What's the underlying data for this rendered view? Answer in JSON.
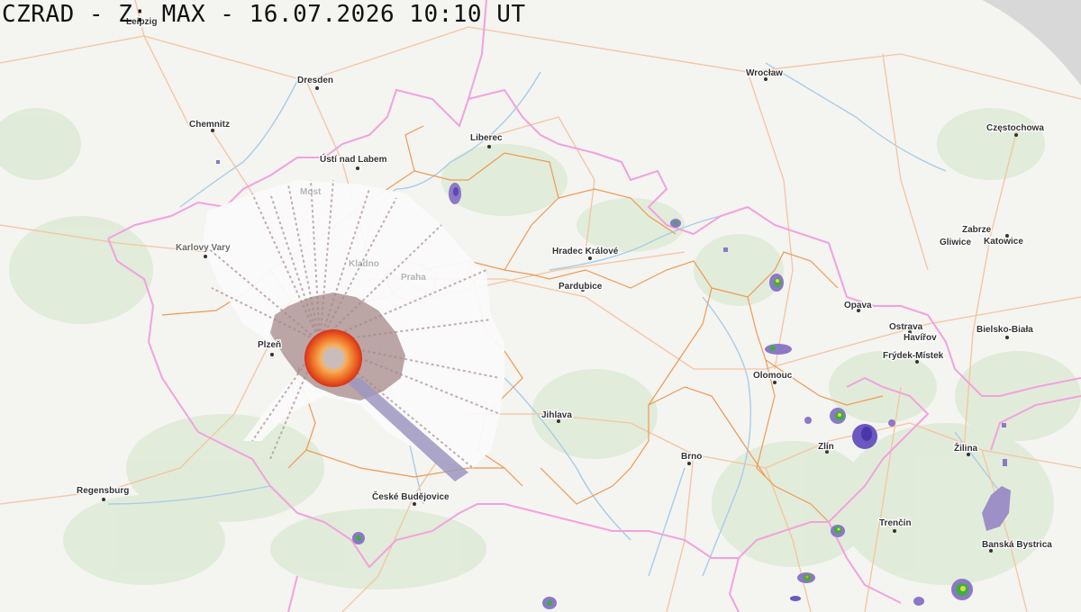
{
  "header": {
    "title": "CZRAD - Z: MAX - 16.07.2026 10:10 UT"
  },
  "colors": {
    "country_border": "#f3a3e0",
    "region_border": "#ef9a50",
    "road": "#f6c8a6",
    "water": "#a8cde8",
    "forest": "#dce9d4",
    "background": "#f4f4f1",
    "radar_coverage": "#fafafa",
    "echo_weak": "#8c78c6",
    "echo_moderate": "#3fae3f",
    "echo_strong": "#f29a1c",
    "echo_intense": "#e23c1c",
    "clutter": "#a08888"
  },
  "cities": [
    {
      "id": "leipzig",
      "name": "Leipzig"
    },
    {
      "id": "dresden",
      "name": "Dresden"
    },
    {
      "id": "chemnitz",
      "name": "Chemnitz"
    },
    {
      "id": "wroclaw",
      "name": "Wrocław"
    },
    {
      "id": "czestochowa",
      "name": "Częstochowa"
    },
    {
      "id": "liberec",
      "name": "Liberec"
    },
    {
      "id": "usti",
      "name": "Ústí nad Labem"
    },
    {
      "id": "most",
      "name": "Most"
    },
    {
      "id": "karlovy-vary",
      "name": "Karlovy Vary"
    },
    {
      "id": "kladno",
      "name": "Kladno"
    },
    {
      "id": "praha",
      "name": "Praha"
    },
    {
      "id": "hradec",
      "name": "Hradec Králové"
    },
    {
      "id": "pardubice",
      "name": "Pardubice"
    },
    {
      "id": "zabrze",
      "name": "Zabrze"
    },
    {
      "id": "gliwice",
      "name": "Gliwice"
    },
    {
      "id": "katowice",
      "name": "Katowice"
    },
    {
      "id": "opava",
      "name": "Opava"
    },
    {
      "id": "ostrava",
      "name": "Ostrava"
    },
    {
      "id": "havirov",
      "name": "Havířov"
    },
    {
      "id": "frydek",
      "name": "Frýdek-Místek"
    },
    {
      "id": "bielsko",
      "name": "Bielsko-Biała"
    },
    {
      "id": "plzen",
      "name": "Plzeň"
    },
    {
      "id": "olomouc",
      "name": "Olomouc"
    },
    {
      "id": "jihlava",
      "name": "Jihlava"
    },
    {
      "id": "zlin",
      "name": "Zlín"
    },
    {
      "id": "brno",
      "name": "Brno"
    },
    {
      "id": "zilina",
      "name": "Žilina"
    },
    {
      "id": "regensburg",
      "name": "Regensburg"
    },
    {
      "id": "ceske-budejovice",
      "name": "České Budějovice"
    },
    {
      "id": "trencin",
      "name": "Trenčín"
    },
    {
      "id": "banska-bystrica",
      "name": "Banská Bystrica"
    }
  ]
}
